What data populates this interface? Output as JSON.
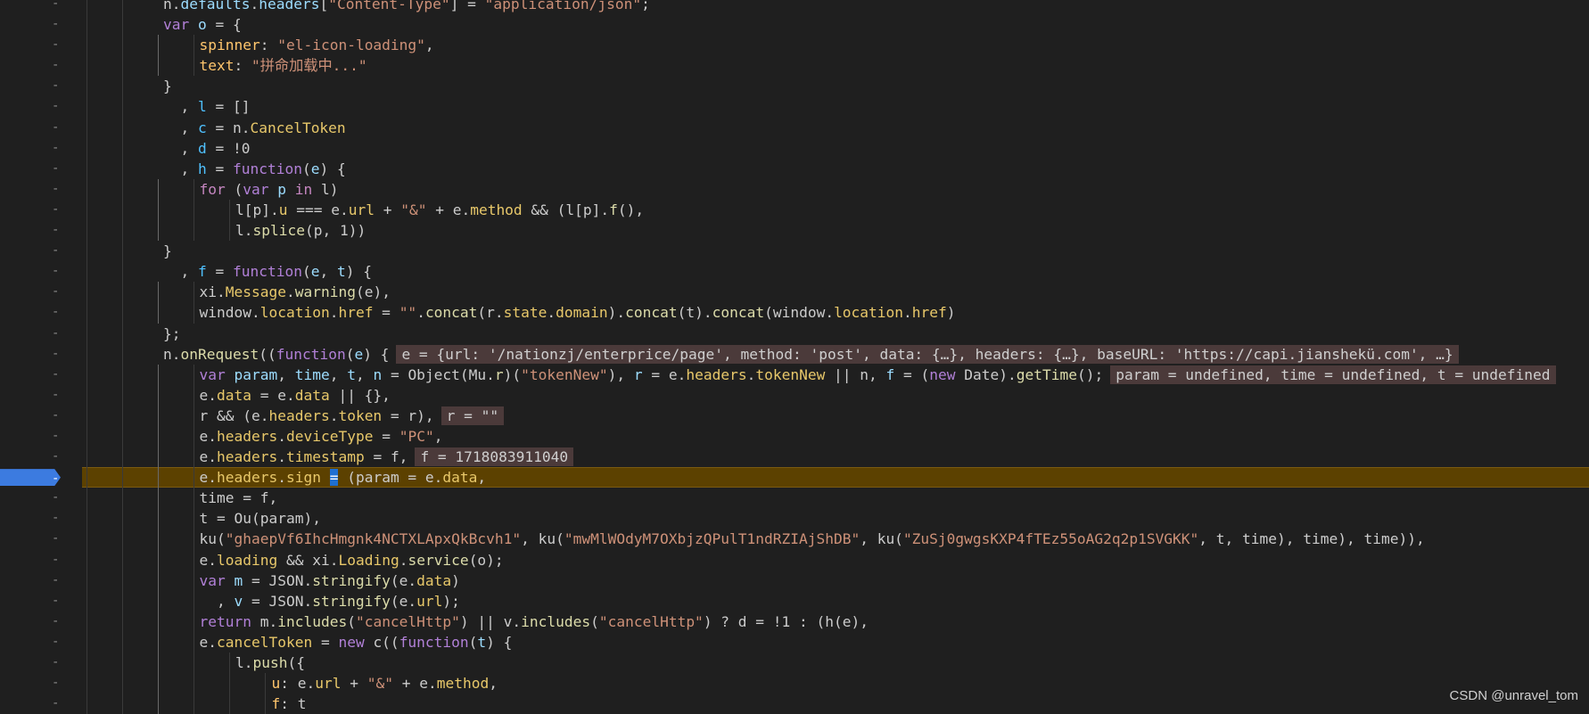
{
  "editor": {
    "lines": [
      {
        "seg": [
          [
            "o",
            "n."
          ],
          [
            "v",
            "defaults"
          ],
          [
            "o",
            "."
          ],
          [
            "v",
            "headers"
          ],
          [
            "o",
            "["
          ],
          [
            "s",
            "\"Content-Type\""
          ],
          [
            "o",
            "] = "
          ],
          [
            "s",
            "\"application/json\""
          ],
          [
            "o",
            ";"
          ]
        ],
        "indent": 3
      },
      {
        "seg": [
          [
            "kw",
            "var "
          ],
          [
            "v",
            "o"
          ],
          [
            "o",
            " = {"
          ]
        ],
        "indent": 3
      },
      {
        "seg": [
          [
            "pr",
            "spinner"
          ],
          [
            "o",
            ": "
          ],
          [
            "s",
            "\"el-icon-loading\""
          ],
          [
            "o",
            ","
          ]
        ],
        "indent": 4
      },
      {
        "seg": [
          [
            "pr",
            "text"
          ],
          [
            "o",
            ": "
          ],
          [
            "s",
            "\"拼命加载中...\""
          ]
        ],
        "indent": 4
      },
      {
        "seg": [
          [
            "o",
            "}"
          ]
        ],
        "indent": 3
      },
      {
        "seg": [
          [
            "o",
            "  , "
          ],
          [
            "vb",
            "l"
          ],
          [
            "o",
            " = []"
          ]
        ],
        "indent": 3
      },
      {
        "seg": [
          [
            "o",
            "  , "
          ],
          [
            "vb",
            "c"
          ],
          [
            "o",
            " = n."
          ],
          [
            "y",
            "CancelToken"
          ]
        ],
        "indent": 3
      },
      {
        "seg": [
          [
            "o",
            "  , "
          ],
          [
            "vb",
            "d"
          ],
          [
            "o",
            " = !0"
          ]
        ],
        "indent": 3
      },
      {
        "seg": [
          [
            "o",
            "  , "
          ],
          [
            "vb",
            "h"
          ],
          [
            "o",
            " = "
          ],
          [
            "kw",
            "function"
          ],
          [
            "o",
            "("
          ],
          [
            "v",
            "e"
          ],
          [
            "o",
            ") {"
          ]
        ],
        "indent": 3
      },
      {
        "seg": [
          [
            "k",
            "for"
          ],
          [
            "o",
            " ("
          ],
          [
            "kw",
            "var "
          ],
          [
            "v",
            "p"
          ],
          [
            "k",
            " in "
          ],
          [
            "o",
            "l)"
          ]
        ],
        "indent": 4
      },
      {
        "seg": [
          [
            "o",
            "l[p]."
          ],
          [
            "y",
            "u"
          ],
          [
            "o",
            " === e."
          ],
          [
            "y",
            "url"
          ],
          [
            "o",
            " + "
          ],
          [
            "s",
            "\"&\""
          ],
          [
            "o",
            " + e."
          ],
          [
            "y",
            "method"
          ],
          [
            "o",
            " && (l[p]."
          ],
          [
            "p",
            "f"
          ],
          [
            "o",
            "(),"
          ]
        ],
        "indent": 5
      },
      {
        "seg": [
          [
            "o",
            "l."
          ],
          [
            "p",
            "splice"
          ],
          [
            "o",
            "(p, 1))"
          ]
        ],
        "indent": 5
      },
      {
        "seg": [
          [
            "o",
            "}"
          ]
        ],
        "indent": 3
      },
      {
        "seg": [
          [
            "o",
            "  , "
          ],
          [
            "vb",
            "f"
          ],
          [
            "o",
            " = "
          ],
          [
            "kw",
            "function"
          ],
          [
            "o",
            "("
          ],
          [
            "v",
            "e"
          ],
          [
            "o",
            ", "
          ],
          [
            "v",
            "t"
          ],
          [
            "o",
            ") {"
          ]
        ],
        "indent": 3
      },
      {
        "seg": [
          [
            "o",
            "xi."
          ],
          [
            "y",
            "Message"
          ],
          [
            "o",
            "."
          ],
          [
            "p",
            "warning"
          ],
          [
            "o",
            "(e),"
          ]
        ],
        "indent": 4
      },
      {
        "seg": [
          [
            "o",
            "window."
          ],
          [
            "y",
            "location"
          ],
          [
            "o",
            "."
          ],
          [
            "y",
            "href"
          ],
          [
            "o",
            " = "
          ],
          [
            "s",
            "\"\""
          ],
          [
            "o",
            "."
          ],
          [
            "p",
            "concat"
          ],
          [
            "o",
            "(r."
          ],
          [
            "y",
            "state"
          ],
          [
            "o",
            "."
          ],
          [
            "y",
            "domain"
          ],
          [
            "o",
            ")."
          ],
          [
            "p",
            "concat"
          ],
          [
            "o",
            "(t)."
          ],
          [
            "p",
            "concat"
          ],
          [
            "o",
            "(window."
          ],
          [
            "y",
            "location"
          ],
          [
            "o",
            "."
          ],
          [
            "y",
            "href"
          ],
          [
            "o",
            ")"
          ]
        ],
        "indent": 4
      },
      {
        "seg": [
          [
            "o",
            "};"
          ]
        ],
        "indent": 3
      },
      {
        "seg": [
          [
            "o",
            "n."
          ],
          [
            "p",
            "onRequest"
          ],
          [
            "o",
            "(("
          ],
          [
            "kw",
            "function"
          ],
          [
            "o",
            "("
          ],
          [
            "v",
            "e"
          ],
          [
            "o",
            ") {"
          ]
        ],
        "indent": 3,
        "hint": "e = {url: '/nationzj/enterprice/page', method: 'post', data: {…}, headers: {…}, baseURL: 'https://capi.jianshekü.com', …}"
      },
      {
        "seg": [
          [
            "kw",
            "var "
          ],
          [
            "v",
            "param"
          ],
          [
            "o",
            ", "
          ],
          [
            "v",
            "time"
          ],
          [
            "o",
            ", "
          ],
          [
            "v",
            "t"
          ],
          [
            "o",
            ", "
          ],
          [
            "v",
            "n"
          ],
          [
            "o",
            " = Object(Mu."
          ],
          [
            "p",
            "r"
          ],
          [
            "o",
            ")("
          ],
          [
            "s",
            "\"tokenNew\""
          ],
          [
            "o",
            "), "
          ],
          [
            "v",
            "r"
          ],
          [
            "o",
            " = e."
          ],
          [
            "y",
            "headers"
          ],
          [
            "o",
            "."
          ],
          [
            "y",
            "tokenNew"
          ],
          [
            "o",
            " || n, "
          ],
          [
            "v",
            "f"
          ],
          [
            "o",
            " = ("
          ],
          [
            "kw",
            "new "
          ],
          [
            "o",
            "Date)."
          ],
          [
            "p",
            "getTime"
          ],
          [
            "o",
            "();"
          ]
        ],
        "indent": 4,
        "hint": "param = undefined, time = undefined, t = undefined"
      },
      {
        "seg": [
          [
            "o",
            "e."
          ],
          [
            "y",
            "data"
          ],
          [
            "o",
            " = e."
          ],
          [
            "y",
            "data"
          ],
          [
            "o",
            " || {},"
          ]
        ],
        "indent": 4
      },
      {
        "seg": [
          [
            "o",
            "r && (e."
          ],
          [
            "y",
            "headers"
          ],
          [
            "o",
            "."
          ],
          [
            "y",
            "token"
          ],
          [
            "o",
            " = r),"
          ]
        ],
        "indent": 4,
        "hint": "r = \"\""
      },
      {
        "seg": [
          [
            "o",
            "e."
          ],
          [
            "y",
            "headers"
          ],
          [
            "o",
            "."
          ],
          [
            "y",
            "deviceType"
          ],
          [
            "o",
            " = "
          ],
          [
            "s",
            "\"PC\""
          ],
          [
            "o",
            ","
          ]
        ],
        "indent": 4
      },
      {
        "seg": [
          [
            "o",
            "e."
          ],
          [
            "y",
            "headers"
          ],
          [
            "o",
            "."
          ],
          [
            "y",
            "timestamp"
          ],
          [
            "o",
            " = f,"
          ]
        ],
        "indent": 4,
        "hint": "f = 1718083911040"
      },
      {
        "seg": [
          [
            "o",
            "e."
          ],
          [
            "y",
            "headers"
          ],
          [
            "o",
            "."
          ],
          [
            "y",
            "sign"
          ],
          [
            "o",
            " "
          ],
          [
            "cur",
            "="
          ],
          [
            "o",
            " (param = e."
          ],
          [
            "y",
            "data"
          ],
          [
            "o",
            ","
          ]
        ],
        "indent": 4,
        "active": true
      },
      {
        "seg": [
          [
            "o",
            "time = f,"
          ]
        ],
        "indent": 4
      },
      {
        "seg": [
          [
            "o",
            "t = Ou(param),"
          ]
        ],
        "indent": 4
      },
      {
        "seg": [
          [
            "o",
            "ku("
          ],
          [
            "s",
            "\"ghaepVf6IhcHmgnk4NCTXLApxQkBcvh1\""
          ],
          [
            "o",
            ", ku("
          ],
          [
            "s",
            "\"mwMlWOdyM7OXbjzQPulT1ndRZIAjShDB\""
          ],
          [
            "o",
            ", ku("
          ],
          [
            "s",
            "\"ZuSj0gwgsKXP4fTEz55oAG2q2p1SVGKK\""
          ],
          [
            "o",
            ", t, time), time), time)),"
          ]
        ],
        "indent": 4
      },
      {
        "seg": [
          [
            "o",
            "e."
          ],
          [
            "y",
            "loading"
          ],
          [
            "o",
            " && xi."
          ],
          [
            "y",
            "Loading"
          ],
          [
            "o",
            "."
          ],
          [
            "p",
            "service"
          ],
          [
            "o",
            "(o);"
          ]
        ],
        "indent": 4
      },
      {
        "seg": [
          [
            "kw",
            "var "
          ],
          [
            "v",
            "m"
          ],
          [
            "o",
            " = JSON."
          ],
          [
            "p",
            "stringify"
          ],
          [
            "o",
            "(e."
          ],
          [
            "y",
            "data"
          ],
          [
            "o",
            ")"
          ]
        ],
        "indent": 4
      },
      {
        "seg": [
          [
            "o",
            "  , "
          ],
          [
            "v",
            "v"
          ],
          [
            "o",
            " = JSON."
          ],
          [
            "p",
            "stringify"
          ],
          [
            "o",
            "(e."
          ],
          [
            "y",
            "url"
          ],
          [
            "o",
            ");"
          ]
        ],
        "indent": 4
      },
      {
        "seg": [
          [
            "kw",
            "return "
          ],
          [
            "o",
            "m."
          ],
          [
            "p",
            "includes"
          ],
          [
            "o",
            "("
          ],
          [
            "s",
            "\"cancelHttp\""
          ],
          [
            "o",
            ") || v."
          ],
          [
            "p",
            "includes"
          ],
          [
            "o",
            "("
          ],
          [
            "s",
            "\"cancelHttp\""
          ],
          [
            "o",
            ") ? d = !1 : (h(e),"
          ]
        ],
        "indent": 4
      },
      {
        "seg": [
          [
            "o",
            "e."
          ],
          [
            "y",
            "cancelToken"
          ],
          [
            "o",
            " = "
          ],
          [
            "kw",
            "new "
          ],
          [
            "o",
            "c(("
          ],
          [
            "kw",
            "function"
          ],
          [
            "o",
            "("
          ],
          [
            "v",
            "t"
          ],
          [
            "o",
            ") {"
          ]
        ],
        "indent": 4
      },
      {
        "seg": [
          [
            "o",
            "l."
          ],
          [
            "p",
            "push"
          ],
          [
            "o",
            "({"
          ]
        ],
        "indent": 5
      },
      {
        "seg": [
          [
            "pr",
            "u"
          ],
          [
            "o",
            ": e."
          ],
          [
            "y",
            "url"
          ],
          [
            "o",
            " + "
          ],
          [
            "s",
            "\"&\""
          ],
          [
            "o",
            " + e."
          ],
          [
            "y",
            "method"
          ],
          [
            "o",
            ","
          ]
        ],
        "indent": 6
      },
      {
        "seg": [
          [
            "pr",
            "f"
          ],
          [
            "o",
            ": t"
          ]
        ],
        "indent": 6
      }
    ],
    "gutter_marker": "-"
  },
  "watermark": "CSDN @unravel_tom"
}
